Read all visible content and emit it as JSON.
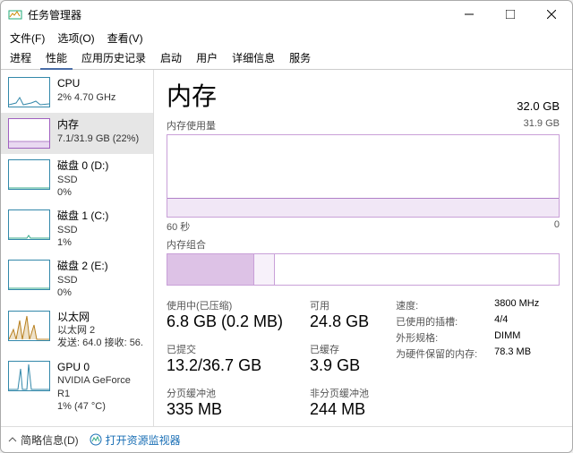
{
  "window": {
    "title": "任务管理器"
  },
  "menu": {
    "file": "文件(F)",
    "options": "选项(O)",
    "view": "查看(V)"
  },
  "tabs": {
    "processes": "进程",
    "performance": "性能",
    "history": "应用历史记录",
    "startup": "启动",
    "users": "用户",
    "details": "详细信息",
    "services": "服务"
  },
  "sidebar": [
    {
      "name": "CPU",
      "sub": "2%  4.70 GHz"
    },
    {
      "name": "内存",
      "sub": "7.1/31.9 GB (22%)"
    },
    {
      "name": "磁盘 0 (D:)",
      "sub": "SSD",
      "sub2": "0%"
    },
    {
      "name": "磁盘 1 (C:)",
      "sub": "SSD",
      "sub2": "1%"
    },
    {
      "name": "磁盘 2 (E:)",
      "sub": "SSD",
      "sub2": "0%"
    },
    {
      "name": "以太网",
      "sub": "以太网 2",
      "sub2": "发送: 64.0  接收: 56."
    },
    {
      "name": "GPU 0",
      "sub": "NVIDIA GeForce R1",
      "sub2": "1%  (47 °C)"
    }
  ],
  "main": {
    "title": "内存",
    "total": "32.0 GB",
    "usage_label": "内存使用量",
    "usage_max": "31.9 GB",
    "axis_left": "60 秒",
    "axis_right": "0",
    "composition_label": "内存组合",
    "stats": {
      "in_use_label": "使用中(已压缩)",
      "in_use": "6.8 GB (0.2 MB)",
      "available_label": "可用",
      "available": "24.8 GB",
      "committed_label": "已提交",
      "committed": "13.2/36.7 GB",
      "cached_label": "已缓存",
      "cached": "3.9 GB",
      "paged_label": "分页缓冲池",
      "paged": "335 MB",
      "nonpaged_label": "非分页缓冲池",
      "nonpaged": "244 MB"
    },
    "specs": {
      "speed_label": "速度:",
      "speed": "3800 MHz",
      "slots_label": "已使用的插槽:",
      "slots": "4/4",
      "form_label": "外形规格:",
      "form": "DIMM",
      "reserved_label": "为硬件保留的内存:",
      "reserved": "78.3 MB"
    }
  },
  "footer": {
    "fewer": "简略信息(D)",
    "resmon": "打开资源监视器"
  },
  "chart_data": {
    "type": "area",
    "title": "内存使用量",
    "x_range_seconds": [
      60,
      0
    ],
    "y_range_gb": [
      0,
      31.9
    ],
    "series": [
      {
        "name": "内存",
        "approx_value_gb": 7.1,
        "approx_percent": 22
      }
    ]
  }
}
